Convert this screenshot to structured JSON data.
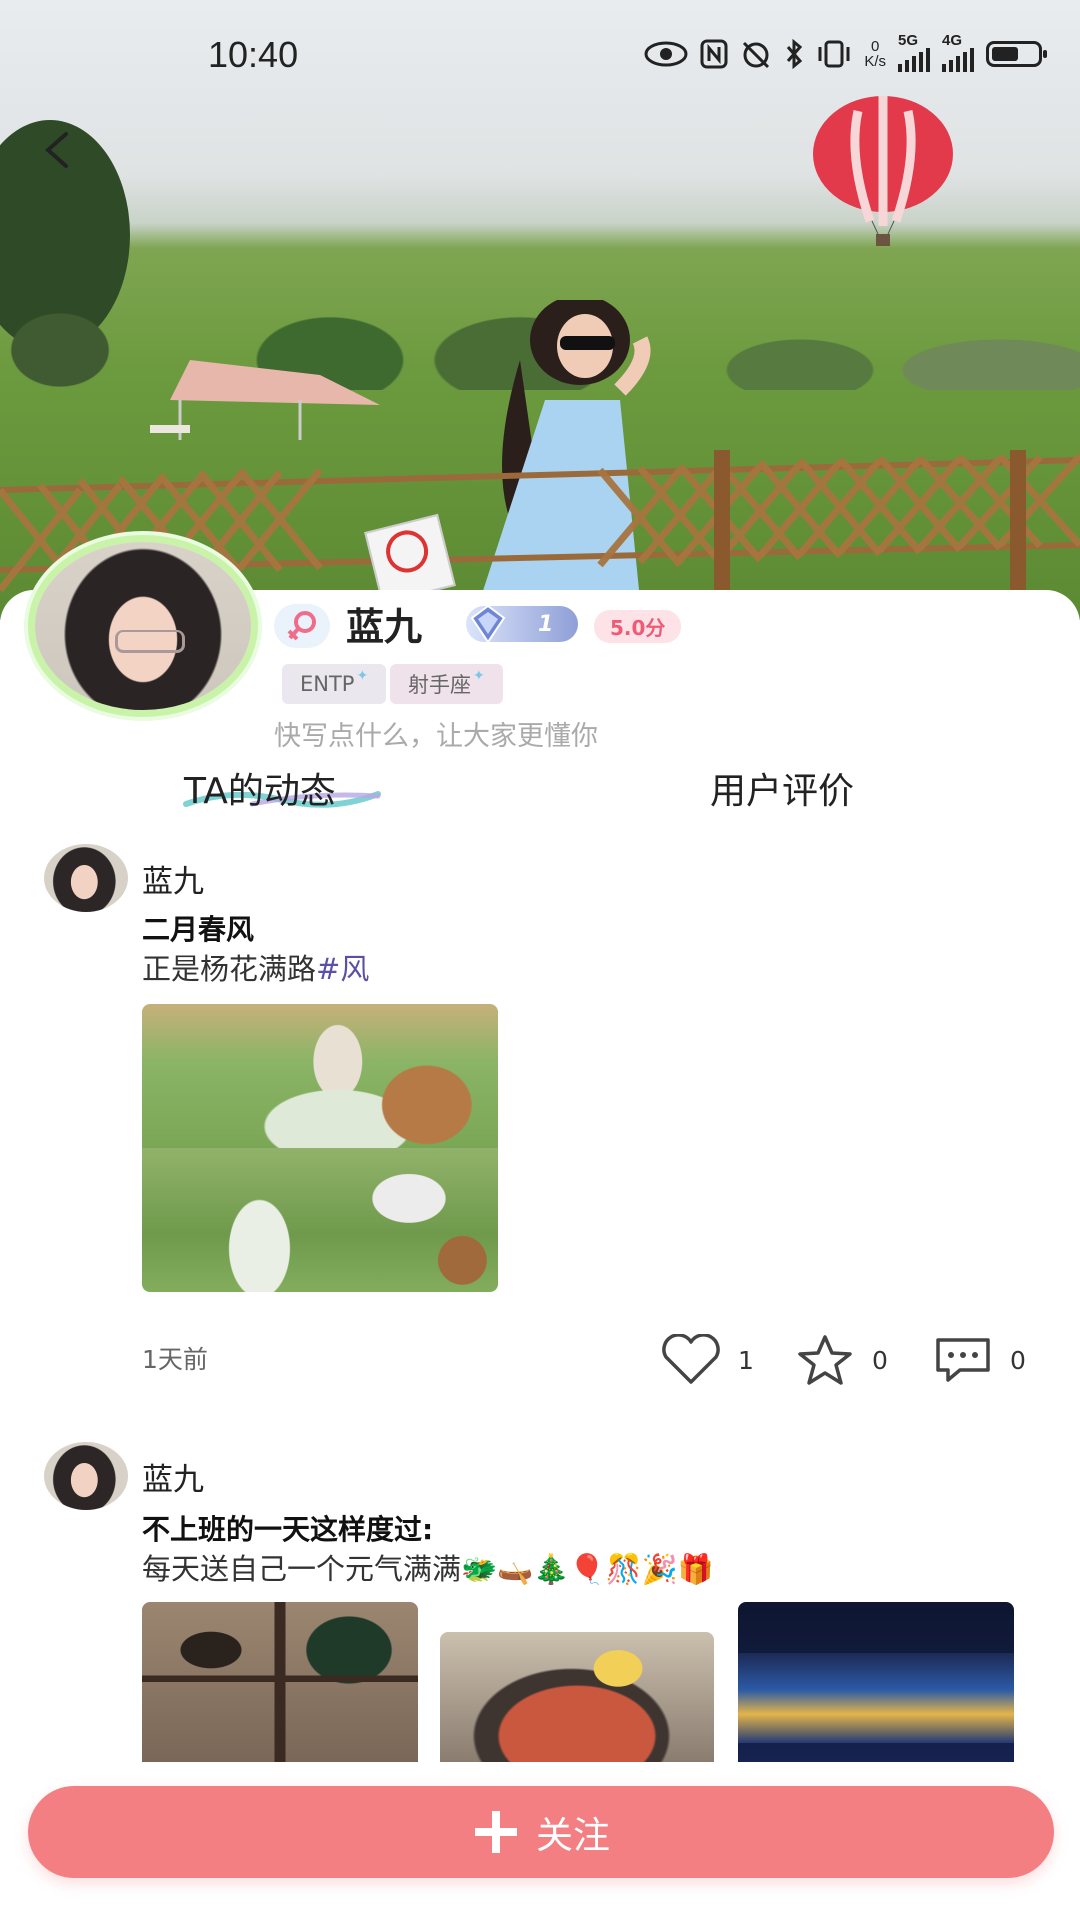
{
  "status_bar": {
    "time": "10:40",
    "net_speed_value": "0",
    "net_speed_unit": "K/s",
    "signal_1_label": "5G",
    "signal_2_label": "4G"
  },
  "profile": {
    "name": "蓝九",
    "level": "1",
    "score": "5.0分",
    "tags": [
      "ENTP",
      "射手座"
    ],
    "bio_placeholder": "快写点什么，让大家更懂你"
  },
  "tabs": [
    {
      "label": "TA的动态",
      "active": true
    },
    {
      "label": "用户评价",
      "active": false
    }
  ],
  "posts": [
    {
      "author": "蓝九",
      "title": "二月春风",
      "text": "正是杨花满路",
      "hashtag": "#风",
      "time": "1天前",
      "likes": "1",
      "favorites": "0",
      "comments": "0"
    },
    {
      "author": "蓝九",
      "title": "不上班的一天这样度过:",
      "text": "每天送自己一个元气满满",
      "emojis": "🐲🛶🎄🎈🎊🎉🎁"
    }
  ],
  "follow_button": {
    "label": "关注",
    "icon": "plus-icon"
  },
  "colors": {
    "accent": "#f47f82",
    "score_text": "#ef5a74",
    "hashtag": "#5b4fa8",
    "avatar_ring": "#c9f3a9"
  }
}
